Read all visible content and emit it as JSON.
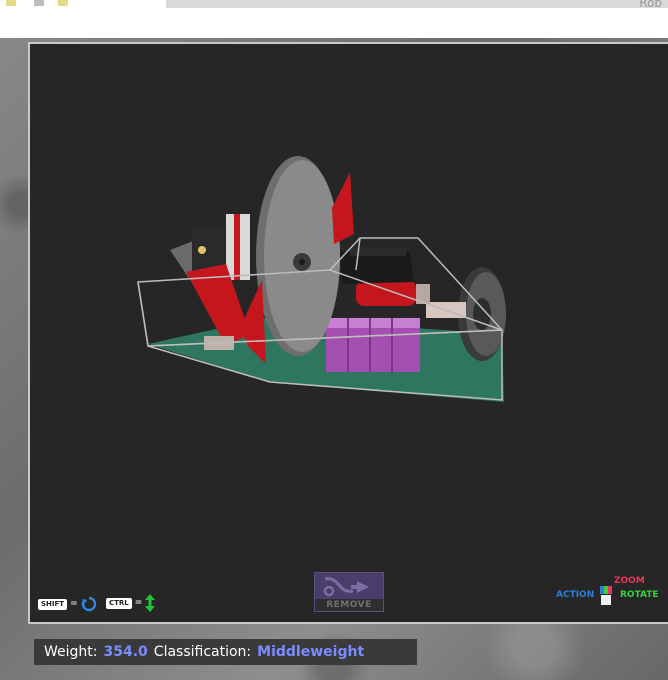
{
  "top_bar": {
    "right_text": "Rob"
  },
  "viewport": {
    "hints": {
      "shift_key": "SHIFT",
      "ctrl_key": "CTRL",
      "equals": "="
    },
    "remove_button": {
      "label": "REMOVE"
    },
    "axis_legend": {
      "zoom": "ZOOM",
      "action": "ACTION",
      "rotate": "ROTATE"
    }
  },
  "info_bar": {
    "weight_label": "Weight:",
    "weight_value": "354.0",
    "class_label": "Classification:",
    "class_value": "Middleweight"
  },
  "colors": {
    "weight_value": "#7b8cff",
    "zoom": "#e8365a",
    "action": "#2f7fd6",
    "rotate": "#3bcf3b",
    "floor": "#2f7a63",
    "battery": "#a64fb3",
    "armor": "#c4161c"
  }
}
